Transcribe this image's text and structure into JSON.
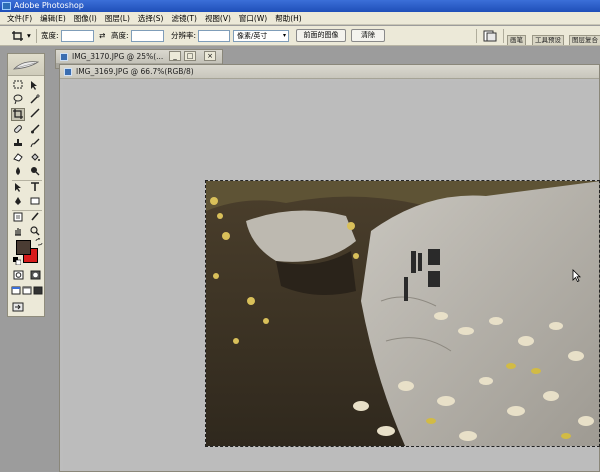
{
  "app": {
    "title": "Adobe Photoshop",
    "icon": "photoshop-icon"
  },
  "menu": [
    "文件(F)",
    "编辑(E)",
    "图像(I)",
    "图层(L)",
    "选择(S)",
    "滤镜(T)",
    "视图(V)",
    "窗口(W)",
    "帮助(H)"
  ],
  "options": {
    "tool_icon": "crop-icon",
    "dropdown_arrow": "▾",
    "width_label": "宽度:",
    "width_value": "",
    "swap_icon": "⇄",
    "height_label": "高度:",
    "height_value": "",
    "resolution_label": "分辨率:",
    "resolution_value": "",
    "unit_select": "像素/英寸",
    "front_image_button": "前面的图像",
    "clear_button": "清除",
    "palette_tabs": [
      "画笔",
      "工具预设",
      "图层复合"
    ]
  },
  "documents": [
    {
      "title": "IMG_3170.JPG @ 25%(...",
      "icon": "document-icon"
    },
    {
      "title": "IMG_3169.JPG @ 66.7%(RGB/8)",
      "icon": "document-icon"
    }
  ],
  "window_buttons": {
    "minimize": "_",
    "maximize": "□",
    "close": "×"
  },
  "colors": {
    "foreground": "#4a3c33",
    "background": "#d81c1c",
    "title_bar": "#1f4fb8"
  }
}
